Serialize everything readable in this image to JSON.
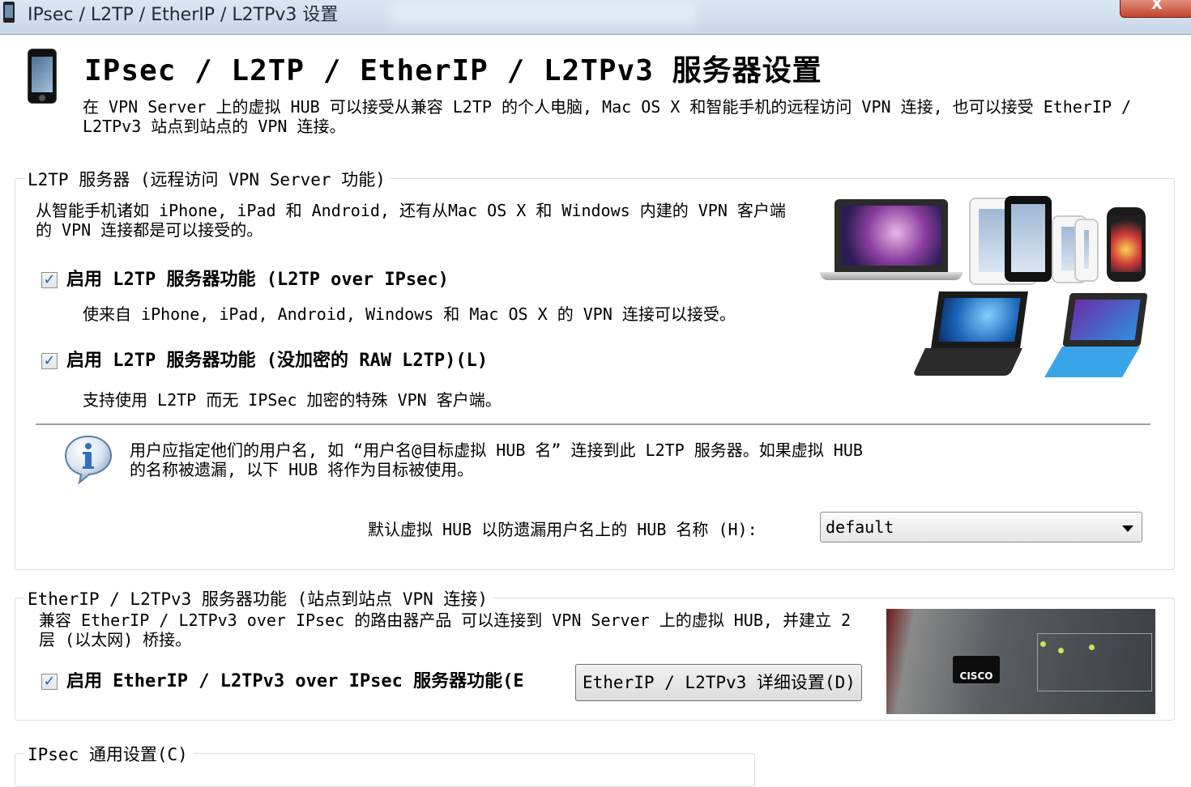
{
  "window": {
    "title": "IPsec / L2TP / EtherIP / L2TPv3 设置",
    "close_glyph": "X"
  },
  "header": {
    "title": "IPsec / L2TP / EtherIP / L2TPv3 服务器设置",
    "description": "在 VPN Server 上的虚拟 HUB 可以接受从兼容 L2TP 的个人电脑, Mac OS X 和智能手机的远程访问 VPN 连接, 也可以接受 EtherIP / L2TPv3 站点到站点的 VPN 连接。"
  },
  "l2tp_group": {
    "label": "L2TP 服务器 (远程访问 VPN Server 功能)",
    "description": "从智能手机诸如 iPhone, iPad 和 Android, 还有从Mac OS X 和 Windows 内建的 VPN 客户端的 VPN 连接都是可以接受的。",
    "option1": {
      "label": "启用 L2TP 服务器功能 (L2TP over IPsec)",
      "checked": true,
      "hint": "使来自 iPhone, iPad, Android, Windows 和 Mac OS X 的 VPN 连接可以接受。"
    },
    "option2": {
      "label": "启用 L2TP 服务器功能 (没加密的 RAW L2TP)(L)",
      "checked": true,
      "hint": "支持使用 L2TP 而无 IPSec 加密的特殊 VPN 客户端。"
    },
    "info_text": "用户应指定他们的用户名, 如 “用户名@目标虚拟 HUB 名” 连接到此 L2TP 服务器。如果虚拟 HUB 的名称被遗漏, 以下 HUB 将作为目标被使用。",
    "default_hub_label": "默认虚拟 HUB 以防遗漏用户名上的 HUB 名称 (H):",
    "default_hub_value": "default"
  },
  "etherip_group": {
    "label": "EtherIP / L2TPv3 服务器功能 (站点到站点 VPN 连接)",
    "description": "兼容 EtherIP / L2TPv3 over IPsec 的路由器产品 可以连接到 VPN Server 上的虚拟 HUB, 并建立 2 层 (以太网) 桥接。",
    "option": {
      "label": "启用 EtherIP / L2TPv3 over IPsec 服务器功能(E",
      "checked": true
    },
    "details_button": "EtherIP / L2TPv3 详细设置(D)",
    "router_logo": "CISCO"
  },
  "ipsec_group": {
    "label": "IPsec 通用设置(C)"
  },
  "check_glyph": "✓",
  "icons": {
    "app": "phone-icon",
    "info": "info-icon",
    "dropdown": "chevron-down-icon"
  },
  "colors": {
    "titlebar": "#c7d6e9",
    "close_button": "#c2442b",
    "check": "#2a5fb3",
    "group_border": "#d5dfe5",
    "info_icon": "#2f6fc8"
  }
}
